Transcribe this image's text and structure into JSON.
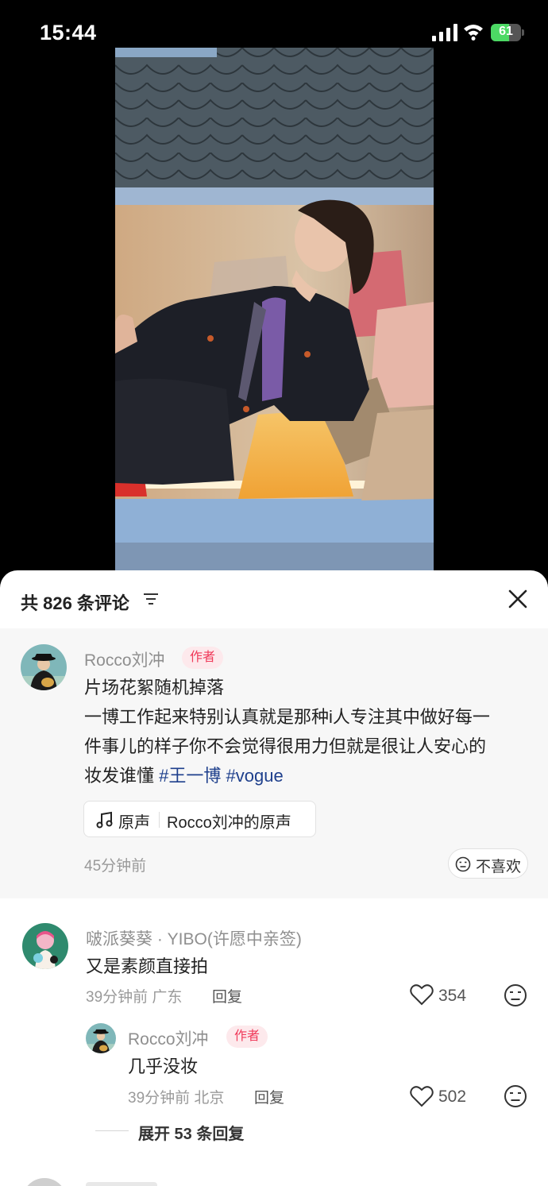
{
  "status_bar": {
    "time": "15:44",
    "battery": "61",
    "battery_level": 0.61
  },
  "comments_panel": {
    "title": "共 826 条评论",
    "pinned": {
      "username": "Rocco刘冲",
      "badge": "作者",
      "line1": "片场花絮随机掉落",
      "line2": "一博工作起来特别认真就是那种i人专注其中做好每一",
      "line3": "件事儿的样子你不会觉得很用力但就是很让人安心的",
      "line4": "妆发谁懂 ",
      "tag1": "#王一博",
      "tag2": "#vogue",
      "audio_label": "原声",
      "audio_name": "Rocco刘冲的原声",
      "time": "45分钟前",
      "dislike": "不喜欢"
    },
    "comment1": {
      "username": "啵派葵葵 · YIBO(许愿中亲签)",
      "text": "又是素颜直接拍",
      "time": "39分钟前 广东",
      "reply": "回复",
      "likes": "354"
    },
    "reply1": {
      "username": "Rocco刘冲",
      "badge": "作者",
      "text": "几乎没妆",
      "time": "39分钟前 北京",
      "reply": "回复",
      "likes": "502"
    },
    "expand": "展开 53 条回复"
  }
}
